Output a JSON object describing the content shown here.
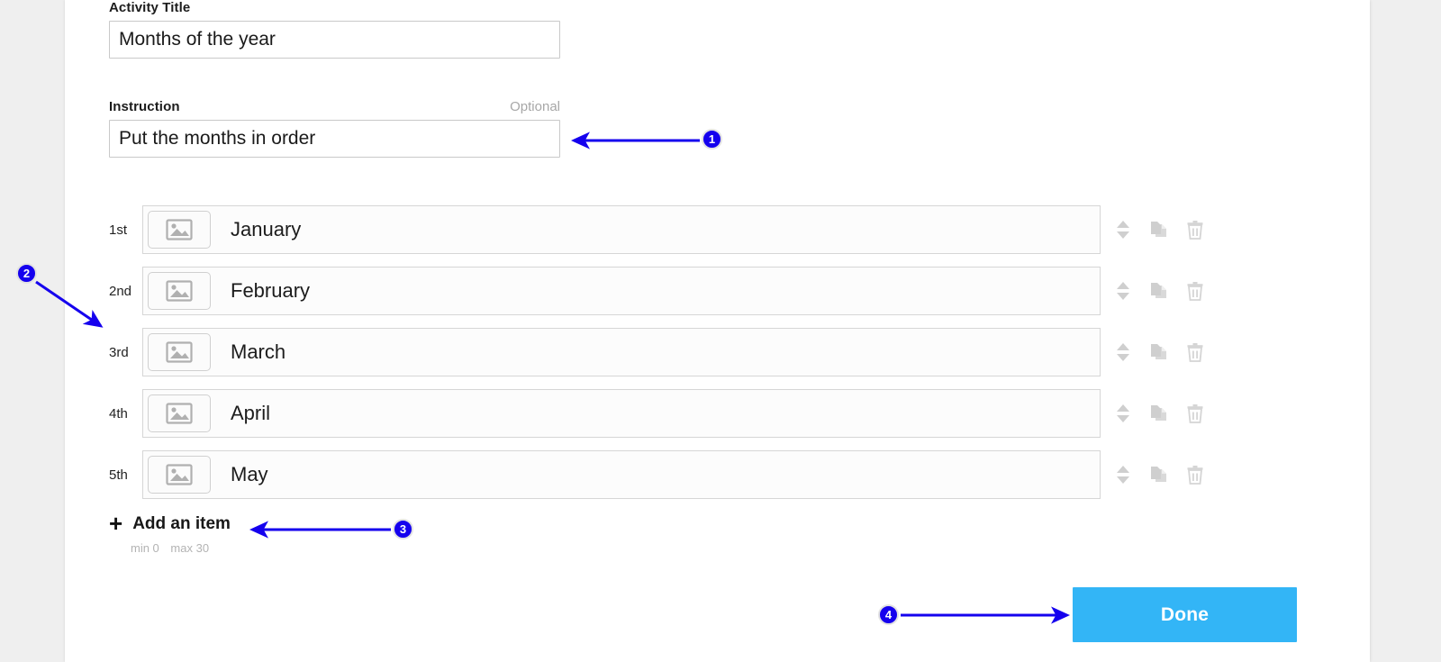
{
  "panel": {
    "background": "#ffffff",
    "page_background": "#efefef"
  },
  "form": {
    "title_field": {
      "label": "Activity Title",
      "value": "Months of the year",
      "placeholder": "Activity Title"
    },
    "instruction_field": {
      "label": "Instruction",
      "optional_label": "Optional",
      "value": "Put the months in order",
      "placeholder": "Instruction"
    }
  },
  "items": [
    {
      "ordinal": "1st",
      "text": "January",
      "image_icon": "image-placeholder-icon"
    },
    {
      "ordinal": "2nd",
      "text": "February",
      "image_icon": "image-placeholder-icon"
    },
    {
      "ordinal": "3rd",
      "text": "March",
      "image_icon": "image-placeholder-icon"
    },
    {
      "ordinal": "4th",
      "text": "April",
      "image_icon": "image-placeholder-icon"
    },
    {
      "ordinal": "5th",
      "text": "May",
      "image_icon": "image-placeholder-icon"
    }
  ],
  "row_actions": {
    "reorder_icon": "sort-updown-icon",
    "duplicate_icon": "duplicate-icon",
    "delete_icon": "trash-icon"
  },
  "add_item": {
    "plus_icon": "plus-icon",
    "label": "Add an item",
    "min_label": "min 0",
    "max_label": "max 30"
  },
  "footer": {
    "done_label": "Done",
    "done_color": "#33b5f6"
  },
  "annotations": {
    "color": "#1500ee",
    "markers": [
      {
        "number": "1",
        "target": "instruction-input"
      },
      {
        "number": "2",
        "target": "items-list"
      },
      {
        "number": "3",
        "target": "add-item-row"
      },
      {
        "number": "4",
        "target": "done-button"
      }
    ]
  }
}
